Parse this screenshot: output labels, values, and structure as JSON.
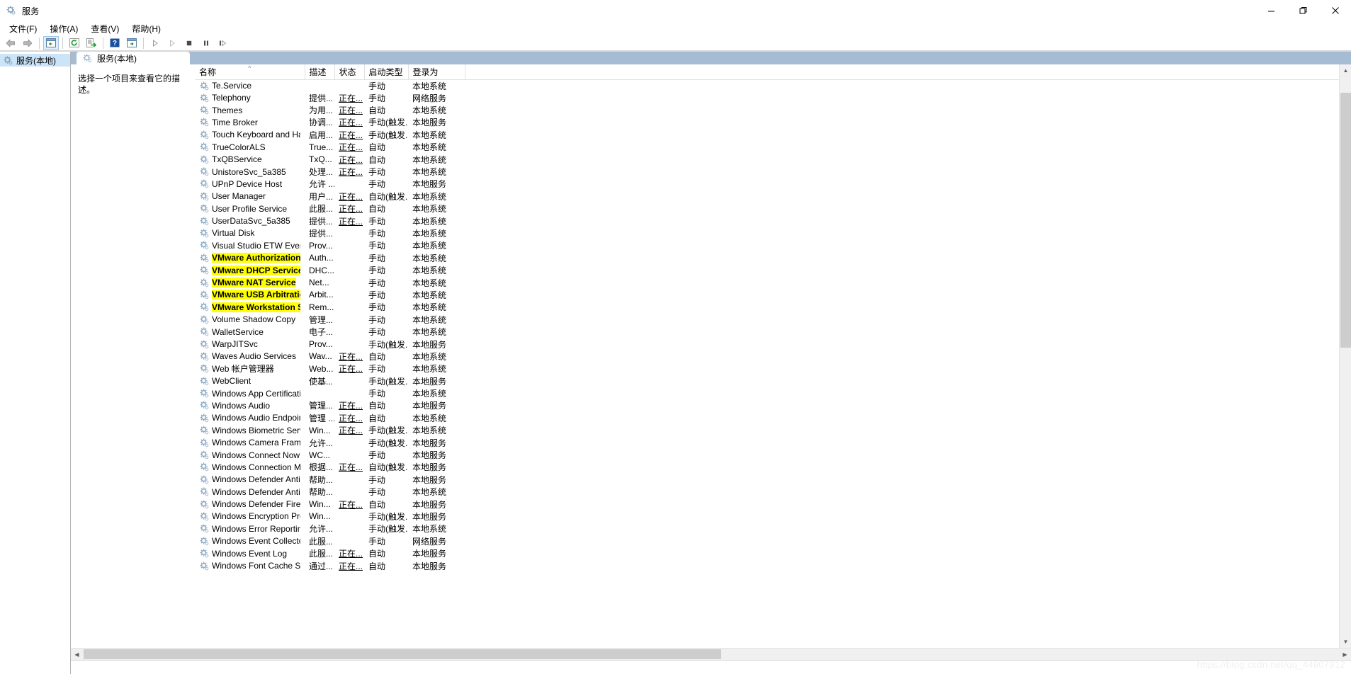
{
  "window": {
    "title": "服务",
    "icon": "gear-icon",
    "minimize_label": "最小化",
    "maximize_label": "还原",
    "close_label": "关闭"
  },
  "menubar": {
    "items": [
      {
        "label": "文件(F)",
        "name": "menu-file"
      },
      {
        "label": "操作(A)",
        "name": "menu-action"
      },
      {
        "label": "查看(V)",
        "name": "menu-view"
      },
      {
        "label": "帮助(H)",
        "name": "menu-help"
      }
    ]
  },
  "toolbar": {
    "buttons": [
      {
        "name": "back-icon",
        "glyph": "back"
      },
      {
        "name": "forward-icon",
        "glyph": "forward"
      },
      {
        "name": "show-hide-tree-icon",
        "glyph": "tree"
      },
      {
        "name": "refresh-icon",
        "glyph": "refresh"
      },
      {
        "name": "export-list-icon",
        "glyph": "export"
      },
      {
        "name": "help-icon",
        "glyph": "help"
      },
      {
        "name": "show-action-pane-icon",
        "glyph": "pane"
      },
      {
        "name": "start-service-icon",
        "glyph": "play"
      },
      {
        "name": "resume-service-icon",
        "glyph": "play2"
      },
      {
        "name": "stop-service-icon",
        "glyph": "stop"
      },
      {
        "name": "pause-service-icon",
        "glyph": "pause"
      },
      {
        "name": "restart-service-icon",
        "glyph": "restart"
      }
    ]
  },
  "tree": {
    "root_label": "服务(本地)"
  },
  "pane": {
    "tab_label": "服务(本地)",
    "description_placeholder": "选择一个项目来查看它的描述。"
  },
  "table": {
    "columns": [
      {
        "label": "名称",
        "name": "column-name",
        "sorted": true
      },
      {
        "label": "描述",
        "name": "column-description",
        "sorted": false
      },
      {
        "label": "状态",
        "name": "column-status",
        "sorted": false
      },
      {
        "label": "启动类型",
        "name": "column-startup-type",
        "sorted": false
      },
      {
        "label": "登录为",
        "name": "column-log-on-as",
        "sorted": false
      }
    ],
    "rows": [
      {
        "name": "Te.Service",
        "desc": "",
        "status": "",
        "startup": "手动",
        "logon": "本地系统",
        "highlight": false
      },
      {
        "name": "Telephony",
        "desc": "提供...",
        "status": "正在...",
        "startup": "手动",
        "logon": "网络服务",
        "highlight": false
      },
      {
        "name": "Themes",
        "desc": "为用...",
        "status": "正在...",
        "startup": "自动",
        "logon": "本地系统",
        "highlight": false
      },
      {
        "name": "Time Broker",
        "desc": "协调...",
        "status": "正在...",
        "startup": "手动(触发...",
        "logon": "本地服务",
        "highlight": false
      },
      {
        "name": "Touch Keyboard and Ha...",
        "desc": "启用...",
        "status": "正在...",
        "startup": "手动(触发...",
        "logon": "本地系统",
        "highlight": false
      },
      {
        "name": "TrueColorALS",
        "desc": "True...",
        "status": "正在...",
        "startup": "自动",
        "logon": "本地系统",
        "highlight": false
      },
      {
        "name": "TxQBService",
        "desc": "TxQ...",
        "status": "正在...",
        "startup": "自动",
        "logon": "本地系统",
        "highlight": false
      },
      {
        "name": "UnistoreSvc_5a385",
        "desc": "处理...",
        "status": "正在...",
        "startup": "手动",
        "logon": "本地系统",
        "highlight": false
      },
      {
        "name": "UPnP Device Host",
        "desc": "允许 ...",
        "status": "",
        "startup": "手动",
        "logon": "本地服务",
        "highlight": false
      },
      {
        "name": "User Manager",
        "desc": "用户...",
        "status": "正在...",
        "startup": "自动(触发...",
        "logon": "本地系统",
        "highlight": false
      },
      {
        "name": "User Profile Service",
        "desc": "此服...",
        "status": "正在...",
        "startup": "自动",
        "logon": "本地系统",
        "highlight": false
      },
      {
        "name": "UserDataSvc_5a385",
        "desc": "提供...",
        "status": "正在...",
        "startup": "手动",
        "logon": "本地系统",
        "highlight": false
      },
      {
        "name": "Virtual Disk",
        "desc": "提供...",
        "status": "",
        "startup": "手动",
        "logon": "本地系统",
        "highlight": false
      },
      {
        "name": "Visual Studio ETW Event ...",
        "desc": "Prov...",
        "status": "",
        "startup": "手动",
        "logon": "本地系统",
        "highlight": false
      },
      {
        "name": "VMware Authorization Se...",
        "desc": "Auth...",
        "status": "",
        "startup": "手动",
        "logon": "本地系统",
        "highlight": true
      },
      {
        "name": "VMware DHCP Service",
        "desc": "DHC...",
        "status": "",
        "startup": "手动",
        "logon": "本地系统",
        "highlight": true
      },
      {
        "name": "VMware NAT Service",
        "desc": "Net...",
        "status": "",
        "startup": "手动",
        "logon": "本地系统",
        "highlight": true
      },
      {
        "name": "VMware USB Arbitration ...",
        "desc": "Arbit...",
        "status": "",
        "startup": "手动",
        "logon": "本地系统",
        "highlight": true
      },
      {
        "name": "VMware Workstation Ser...",
        "desc": "Rem...",
        "status": "",
        "startup": "手动",
        "logon": "本地系统",
        "highlight": true
      },
      {
        "name": "Volume Shadow Copy",
        "desc": "管理...",
        "status": "",
        "startup": "手动",
        "logon": "本地系统",
        "highlight": false
      },
      {
        "name": "WalletService",
        "desc": "电子...",
        "status": "",
        "startup": "手动",
        "logon": "本地系统",
        "highlight": false
      },
      {
        "name": "WarpJITSvc",
        "desc": "Prov...",
        "status": "",
        "startup": "手动(触发...",
        "logon": "本地服务",
        "highlight": false
      },
      {
        "name": "Waves Audio Services",
        "desc": "Wav...",
        "status": "正在...",
        "startup": "自动",
        "logon": "本地系统",
        "highlight": false
      },
      {
        "name": "Web 帐户管理器",
        "desc": "Web...",
        "status": "正在...",
        "startup": "手动",
        "logon": "本地系统",
        "highlight": false
      },
      {
        "name": "WebClient",
        "desc": "使基...",
        "status": "",
        "startup": "手动(触发...",
        "logon": "本地服务",
        "highlight": false
      },
      {
        "name": "Windows App Certificatio...",
        "desc": "",
        "status": "",
        "startup": "手动",
        "logon": "本地系统",
        "highlight": false
      },
      {
        "name": "Windows Audio",
        "desc": "管理...",
        "status": "正在...",
        "startup": "自动",
        "logon": "本地服务",
        "highlight": false
      },
      {
        "name": "Windows Audio Endpoint...",
        "desc": "管理 ...",
        "status": "正在...",
        "startup": "自动",
        "logon": "本地系统",
        "highlight": false
      },
      {
        "name": "Windows Biometric Servi...",
        "desc": "Win...",
        "status": "正在...",
        "startup": "手动(触发...",
        "logon": "本地系统",
        "highlight": false
      },
      {
        "name": "Windows Camera Frame ...",
        "desc": "允许...",
        "status": "",
        "startup": "手动(触发...",
        "logon": "本地服务",
        "highlight": false
      },
      {
        "name": "Windows Connect Now -...",
        "desc": "WC...",
        "status": "",
        "startup": "手动",
        "logon": "本地服务",
        "highlight": false
      },
      {
        "name": "Windows Connection Ma...",
        "desc": "根据...",
        "status": "正在...",
        "startup": "自动(触发...",
        "logon": "本地服务",
        "highlight": false
      },
      {
        "name": "Windows Defender Antivi...",
        "desc": "帮助...",
        "status": "",
        "startup": "手动",
        "logon": "本地服务",
        "highlight": false
      },
      {
        "name": "Windows Defender Antivi...",
        "desc": "帮助...",
        "status": "",
        "startup": "手动",
        "logon": "本地系统",
        "highlight": false
      },
      {
        "name": "Windows Defender Firew...",
        "desc": "Win...",
        "status": "正在...",
        "startup": "自动",
        "logon": "本地服务",
        "highlight": false
      },
      {
        "name": "Windows Encryption Pro...",
        "desc": "Win...",
        "status": "",
        "startup": "手动(触发...",
        "logon": "本地服务",
        "highlight": false
      },
      {
        "name": "Windows Error Reportin...",
        "desc": "允许...",
        "status": "",
        "startup": "手动(触发...",
        "logon": "本地系统",
        "highlight": false
      },
      {
        "name": "Windows Event Collector",
        "desc": "此服...",
        "status": "",
        "startup": "手动",
        "logon": "网络服务",
        "highlight": false
      },
      {
        "name": "Windows Event Log",
        "desc": "此服...",
        "status": "正在...",
        "startup": "自动",
        "logon": "本地服务",
        "highlight": false
      },
      {
        "name": "Windows Font Cache Ser...",
        "desc": "通过...",
        "status": "正在...",
        "startup": "自动",
        "logon": "本地服务",
        "highlight": false
      }
    ]
  },
  "watermark": {
    "text": "https://blog.csdn.net/qq_44907912"
  }
}
